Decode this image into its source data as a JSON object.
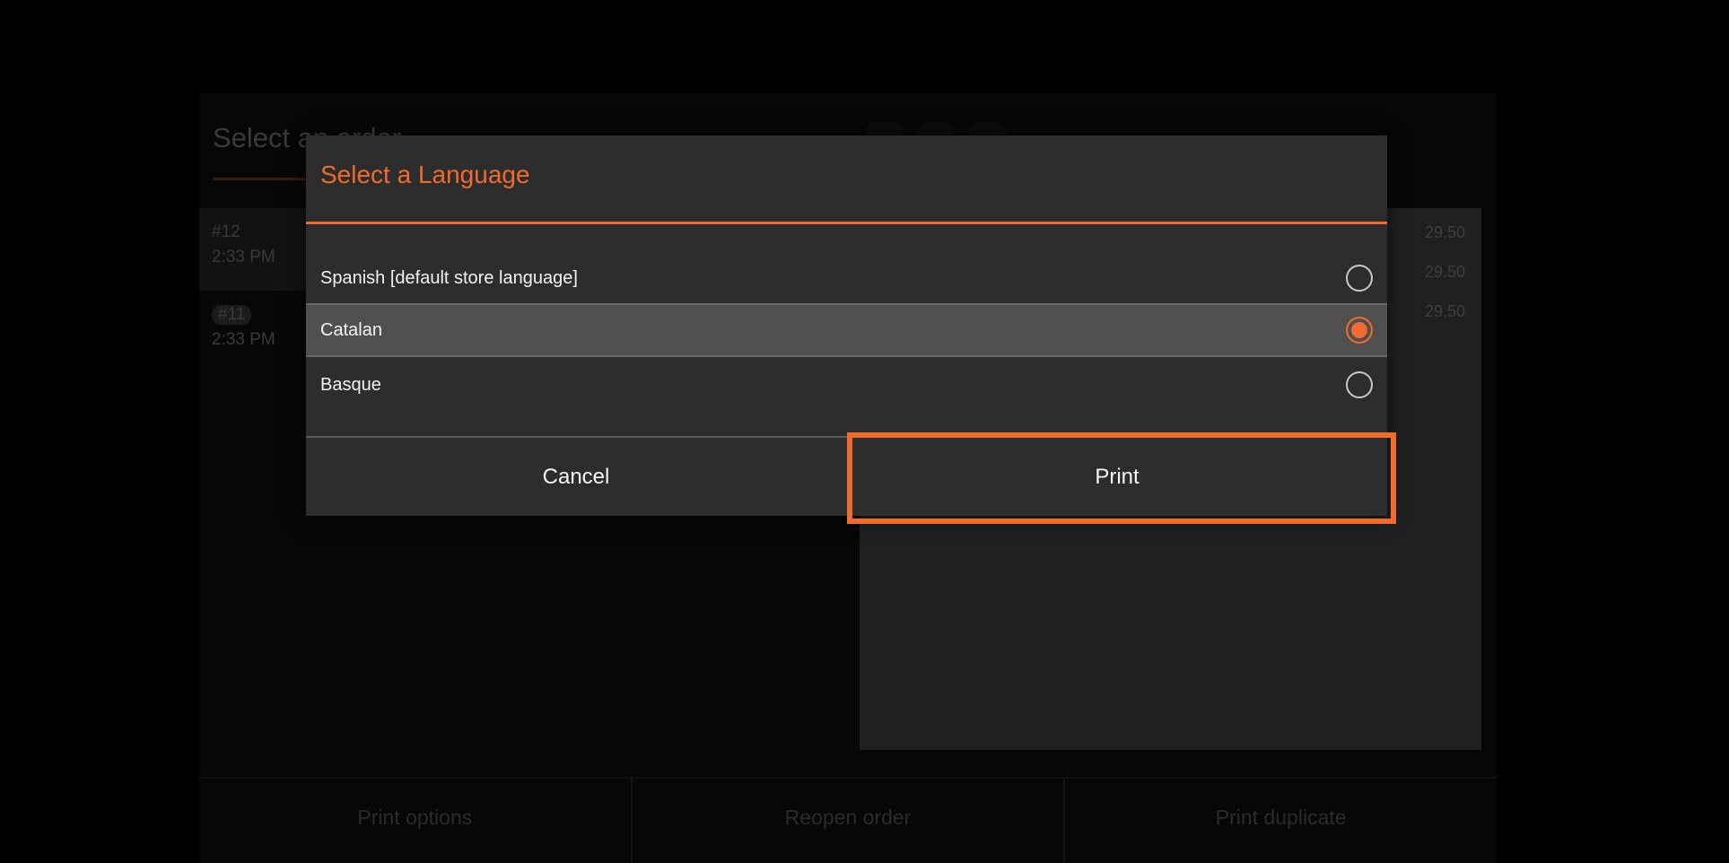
{
  "background": {
    "title": "Select an order",
    "orders": [
      {
        "number": "#12",
        "time": "2:33 PM"
      },
      {
        "number": "#11",
        "time": "2:33 PM"
      }
    ],
    "prices": [
      "29.50",
      "29.50",
      "29.50"
    ],
    "actions": {
      "print_options": "Print options",
      "reopen_order": "Reopen order",
      "print_duplicate": "Print duplicate"
    }
  },
  "dialog": {
    "title": "Select a Language",
    "options": [
      {
        "label": "Spanish [default store language]",
        "selected": false
      },
      {
        "label": "Catalan",
        "selected": true
      },
      {
        "label": "Basque",
        "selected": false
      }
    ],
    "cancel_label": "Cancel",
    "print_label": "Print"
  },
  "colors": {
    "accent": "#ef6c2e",
    "dialog_bg": "#2d2d2d",
    "selected_row_bg": "#505050"
  }
}
